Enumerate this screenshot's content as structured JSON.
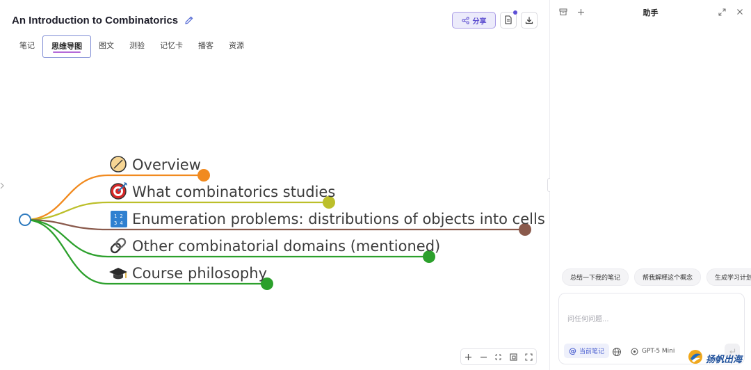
{
  "document": {
    "title": "An Introduction to Combinatorics"
  },
  "tabs": [
    {
      "label": "笔记"
    },
    {
      "label": "思维导图",
      "active": true
    },
    {
      "label": "图文"
    },
    {
      "label": "测验"
    },
    {
      "label": "记忆卡"
    },
    {
      "label": "播客"
    },
    {
      "label": "资源"
    }
  ],
  "toolbar": {
    "share_label": "分享",
    "doc_icon": "document-icon",
    "download_icon": "download-icon",
    "has_notification": true
  },
  "mindmap": {
    "root_color": "#2f7bbf",
    "nodes": [
      {
        "label": "Overview",
        "icon": "compass-icon",
        "color": "#f18a1f"
      },
      {
        "label": "What combinatorics studies",
        "icon": "target-icon",
        "color": "#bcbf2a"
      },
      {
        "label": "Enumeration problems: distributions of objects into cells",
        "icon": "numbers-icon",
        "color": "#8a5a4c"
      },
      {
        "label": "Other combinatorial domains (mentioned)",
        "icon": "link-icon",
        "color": "#2ca02c"
      },
      {
        "label": "Course philosophy",
        "icon": "graduation-cap-icon",
        "color": "#2ca02c"
      }
    ]
  },
  "zoom_controls": [
    "zoom-in-icon",
    "zoom-out-icon",
    "fit-icon",
    "minimap-icon",
    "fullscreen-icon"
  ],
  "assistant": {
    "title": "助手",
    "suggestions": [
      {
        "label": "总结一下我的笔记"
      },
      {
        "label": "帮我解释这个概念"
      },
      {
        "label": "生成学习计划"
      }
    ],
    "input": {
      "placeholder": "问任何问题..."
    },
    "context_label": "当前笔记",
    "model_label": "GPT-5 Mini"
  },
  "watermark": {
    "text": "扬帆出海"
  }
}
